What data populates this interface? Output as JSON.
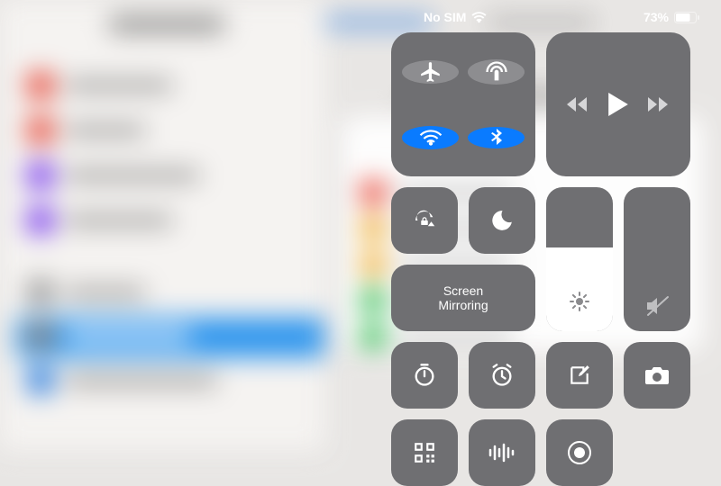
{
  "status": {
    "sim": "No SIM",
    "battery_pct": "73%"
  },
  "connectivity": {
    "airplane": {
      "on": false
    },
    "cellular": {
      "on": false
    },
    "wifi": {
      "on": true
    },
    "bluetooth": {
      "on": true
    }
  },
  "screen_mirroring_label": "Screen\nMirroring",
  "brightness_pct": 58,
  "volume_muted": true,
  "colors": {
    "tile": "#6f6f72",
    "active": "#0a7bff"
  }
}
